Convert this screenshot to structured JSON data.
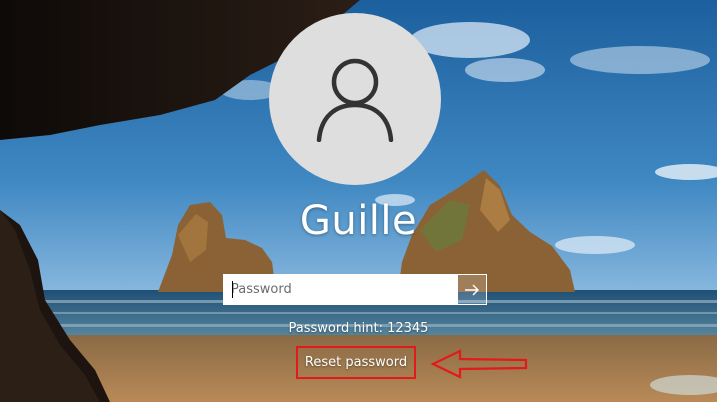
{
  "user": {
    "name": "Guille",
    "avatar_icon": "user-silhouette-icon"
  },
  "login": {
    "password_placeholder": "Password",
    "submit_icon": "arrow-right-icon",
    "hint": "Password hint: 12345",
    "reset_label": "Reset password"
  },
  "annotation": {
    "highlight_color": "#e21a1a",
    "arrow_icon": "left-arrow-icon"
  }
}
